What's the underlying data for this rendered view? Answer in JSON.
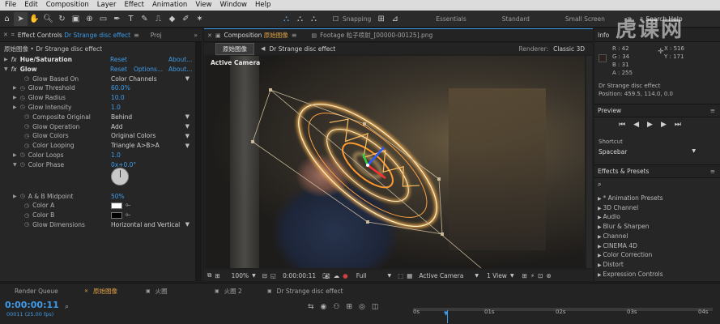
{
  "menu": [
    "File",
    "Edit",
    "Composition",
    "Layer",
    "Effect",
    "Animation",
    "View",
    "Window",
    "Help"
  ],
  "toolbar": {
    "snapping_label": "Snapping",
    "workspaces": [
      "Essentials",
      "Standard",
      "Small Screen"
    ],
    "search_placeholder": "Search Help"
  },
  "watermark": "虎课网",
  "effect_controls": {
    "tab_label": "Effect Controls",
    "tab_layer": "Dr Strange disc effect",
    "tab_proj": "Proj",
    "layer_path": "原始图像 • Dr Strange disc effect",
    "hue_saturation": {
      "name": "Hue/Saturation",
      "reset": "Reset",
      "about": "About..."
    },
    "glow": {
      "name": "Glow",
      "reset": "Reset",
      "options": "Options...",
      "about": "About..."
    },
    "properties": [
      {
        "label": "Glow Based On",
        "value": "Color Channels",
        "kind": "dropdown"
      },
      {
        "label": "Glow Threshold",
        "value": "60.0%",
        "kind": "value"
      },
      {
        "label": "Glow Radius",
        "value": "10.0",
        "kind": "value"
      },
      {
        "label": "Glow Intensity",
        "value": "1.0",
        "kind": "value"
      },
      {
        "label": "Composite Original",
        "value": "Behind",
        "kind": "dropdown"
      },
      {
        "label": "Glow Operation",
        "value": "Add",
        "kind": "dropdown"
      },
      {
        "label": "Glow Colors",
        "value": "Original Colors",
        "kind": "dropdown"
      },
      {
        "label": "Color Looping",
        "value": "Triangle A>B>A",
        "kind": "dropdown"
      },
      {
        "label": "Color Loops",
        "value": "1.0",
        "kind": "value"
      },
      {
        "label": "Color Phase",
        "value": "0x+0.0°",
        "kind": "value"
      }
    ],
    "properties_2": [
      {
        "label": "A & B Midpoint",
        "value": "50%",
        "kind": "value"
      },
      {
        "label": "Color A",
        "value": "",
        "kind": "swatch",
        "color": "#ffffff"
      },
      {
        "label": "Color B",
        "value": "",
        "kind": "swatch",
        "color": "#000000"
      },
      {
        "label": "Glow Dimensions",
        "value": "Horizontal and Vertical",
        "kind": "dropdown"
      }
    ]
  },
  "composition": {
    "tab_label": "Composition",
    "tab_comp": "原始图像",
    "footage_label": "Footage",
    "footage_name": "粒子喷射_[00000-00125].png",
    "breadcrumb_comp": "原始图像",
    "breadcrumb_layer": "Dr Strange disc effect",
    "renderer_label": "Renderer:",
    "renderer_value": "Classic 3D",
    "view_label": "Active Camera",
    "footer": {
      "zoom": "100%",
      "timecode": "0:00:00:11",
      "resolution": "Full",
      "camera": "Active Camera",
      "views": "1 View"
    }
  },
  "info": {
    "title": "Info",
    "r": "R : 42",
    "g": "G : 34",
    "b": "B : 31",
    "a": "A : 255",
    "x": "X : 516",
    "y": "Y : 171",
    "layer": "Dr Strange disc effect",
    "position": "Position: 459.5, 114.0, 0.0"
  },
  "preview": {
    "title": "Preview",
    "shortcut_label": "Shortcut",
    "shortcut_value": "Spacebar"
  },
  "effects_presets": {
    "title": "Effects & Presets",
    "search_placeholder": "",
    "items": [
      "* Animation Presets",
      "3D Channel",
      "Audio",
      "Blur & Sharpen",
      "Channel",
      "CINEMA 4D",
      "Color Correction",
      "Distort",
      "Expression Controls"
    ]
  },
  "timeline": {
    "render_queue": "Render Queue",
    "tabs": [
      "原始图像",
      "火圈",
      "火圈 2",
      "Dr Strange disc effect"
    ],
    "timecode": "0:00:00:11",
    "frame_info": "00011 (25.00 fps)",
    "ruler": [
      "0s",
      "01s",
      "02s",
      "03s",
      "04s"
    ]
  },
  "colors": {
    "accent": "#3e9be9",
    "highlight": "#e0a040"
  }
}
